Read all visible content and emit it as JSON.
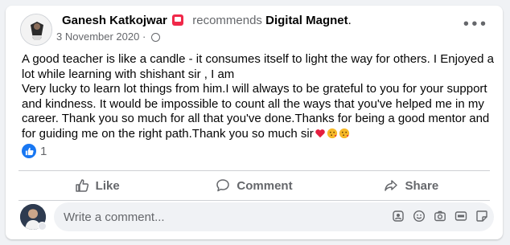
{
  "post": {
    "author": "Ganesh Katkojwar",
    "action": "recommends",
    "page_name": "Digital Magnet",
    "punctuation": ".",
    "date": "3 November 2020",
    "separator": "·",
    "paragraphs": [
      "A good teacher is like a candle - it consumes itself to light the way for others. I Enjoyed a lot while learning with shishant sir , I am",
      "Very lucky to learn lot things from him.I will always to be grateful to you for your support and kindness. It would be impossible to count all the ways that you've helped me in my career. Thank you so much for all that you've done.Thanks for being a good mentor and for guiding me on the right path.Thank you so much sir"
    ],
    "reaction_count": "1"
  },
  "actions": {
    "like_label": "Like",
    "comment_label": "Comment",
    "share_label": "Share"
  },
  "comment_box": {
    "placeholder": "Write a comment..."
  },
  "icons": {
    "more": "more-options-icon",
    "globe": "globe-icon",
    "badge": "recommendation-badge-icon",
    "like_reaction": "like-reaction-icon",
    "emojis": [
      "red-heart-emoji",
      "face-blowing-kiss-emoji",
      "face-blowing-kiss-emoji"
    ]
  },
  "colors": {
    "accent": "#1877f2",
    "badge": "#f02849",
    "secondary_text": "#65676b",
    "background": "#f0f2f5"
  }
}
